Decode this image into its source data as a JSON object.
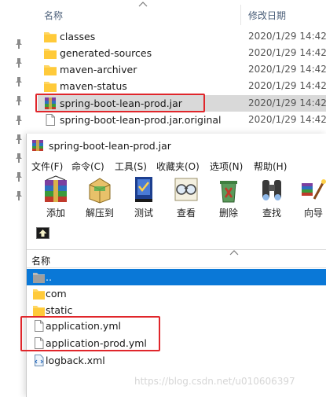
{
  "explorer": {
    "columns": {
      "name": "名称",
      "date": "修改日期"
    },
    "rows": [
      {
        "name": "classes",
        "date": "2020/1/29 14:42",
        "icon": "folder-icon",
        "selected": false
      },
      {
        "name": "generated-sources",
        "date": "2020/1/29 14:42",
        "icon": "folder-icon",
        "selected": false
      },
      {
        "name": "maven-archiver",
        "date": "2020/1/29 14:42",
        "icon": "folder-icon",
        "selected": false
      },
      {
        "name": "maven-status",
        "date": "2020/1/29 14:42",
        "icon": "folder-icon",
        "selected": false
      },
      {
        "name": "spring-boot-lean-prod.jar",
        "date": "2020/1/29 14:42",
        "icon": "winrar-archive-icon",
        "selected": true
      },
      {
        "name": "spring-boot-lean-prod.jar.original",
        "date": "2020/1/29 14:42",
        "icon": "file-icon",
        "selected": false
      }
    ]
  },
  "winrar": {
    "title": "spring-boot-lean-prod.jar",
    "menu": [
      "文件(F)",
      "命令(C)",
      "工具(S)",
      "收藏夹(O)",
      "选项(N)",
      "帮助(H)"
    ],
    "tools": [
      {
        "label": "添加",
        "icon": "add-archive-icon"
      },
      {
        "label": "解压到",
        "icon": "extract-to-icon"
      },
      {
        "label": "测试",
        "icon": "test-icon"
      },
      {
        "label": "查看",
        "icon": "view-glasses-icon"
      },
      {
        "label": "删除",
        "icon": "delete-recycle-icon"
      },
      {
        "label": "查找",
        "icon": "find-binoculars-icon"
      },
      {
        "label": "向导",
        "icon": "wizard-icon"
      }
    ],
    "list_header": "名称",
    "rows": [
      {
        "name": "..",
        "icon": "parent-folder-icon",
        "selected": true
      },
      {
        "name": "com",
        "icon": "folder-icon",
        "selected": false
      },
      {
        "name": "static",
        "icon": "folder-icon",
        "selected": false
      },
      {
        "name": "application.yml",
        "icon": "file-icon",
        "selected": false
      },
      {
        "name": "application-prod.yml",
        "icon": "file-icon",
        "selected": false
      },
      {
        "name": "logback.xml",
        "icon": "xml-file-icon",
        "selected": false
      }
    ]
  },
  "watermark": "https://blog.csdn.net/u010606397",
  "colors": {
    "highlight_red": "#e0262b",
    "selection_blue": "#0a78d7",
    "explorer_selected": "#d9d9d9",
    "folder": "#ffd764"
  }
}
